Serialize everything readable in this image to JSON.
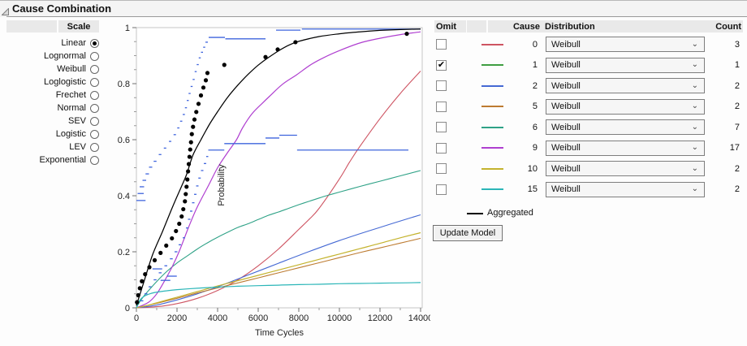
{
  "header": {
    "title": "Cause Combination"
  },
  "scale_panel": {
    "header": "Scale",
    "options": [
      {
        "label": "Linear",
        "selected": true
      },
      {
        "label": "Lognormal",
        "selected": false
      },
      {
        "label": "Weibull",
        "selected": false
      },
      {
        "label": "Loglogistic",
        "selected": false
      },
      {
        "label": "Frechet",
        "selected": false
      },
      {
        "label": "Normal",
        "selected": false
      },
      {
        "label": "SEV",
        "selected": false
      },
      {
        "label": "Logistic",
        "selected": false
      },
      {
        "label": "LEV",
        "selected": false
      },
      {
        "label": "Exponential",
        "selected": false
      }
    ]
  },
  "causes_table": {
    "headers": {
      "omit": "Omit",
      "cause": "Cause",
      "distribution": "Distribution",
      "count": "Count"
    },
    "distribution_selected": "Weibull",
    "rows": [
      {
        "omit": false,
        "color": "#ce5462",
        "cause": "0",
        "distribution": "Weibull",
        "count": "3"
      },
      {
        "omit": true,
        "color": "#3f9e42",
        "cause": "1",
        "distribution": "Weibull",
        "count": "1"
      },
      {
        "omit": false,
        "color": "#4569d4",
        "cause": "2",
        "distribution": "Weibull",
        "count": "2"
      },
      {
        "omit": false,
        "color": "#bd7b31",
        "cause": "5",
        "distribution": "Weibull",
        "count": "2"
      },
      {
        "omit": false,
        "color": "#2fa287",
        "cause": "6",
        "distribution": "Weibull",
        "count": "7"
      },
      {
        "omit": false,
        "color": "#af3fd0",
        "cause": "9",
        "distribution": "Weibull",
        "count": "17"
      },
      {
        "omit": false,
        "color": "#c4b32e",
        "cause": "10",
        "distribution": "Weibull",
        "count": "2"
      },
      {
        "omit": false,
        "color": "#2cb6b8",
        "cause": "15",
        "distribution": "Weibull",
        "count": "2"
      }
    ],
    "aggregated_label": "Aggregated",
    "aggregated_color": "#000000"
  },
  "update_button": "Update Model",
  "chart_data": {
    "type": "line",
    "xlabel": "Time Cycles",
    "ylabel": "Probability",
    "xlim": [
      0,
      14000
    ],
    "ylim": [
      0,
      1
    ],
    "xticks": [
      0,
      2000,
      4000,
      6000,
      8000,
      10000,
      12000,
      14000
    ],
    "yticks": [
      0,
      0.2,
      0.4,
      0.6,
      0.8,
      1
    ],
    "x_minor_step": 1000,
    "y_minor_step": 0.05,
    "grid": false,
    "legend_position": "right-table",
    "series": [
      {
        "name": "cause-0",
        "color": "#ce5462",
        "width": 1.1,
        "points": [
          [
            0,
            0
          ],
          [
            1000,
            0.004
          ],
          [
            2000,
            0.015
          ],
          [
            3000,
            0.034
          ],
          [
            4000,
            0.062
          ],
          [
            5000,
            0.1
          ],
          [
            6000,
            0.15
          ],
          [
            7000,
            0.21
          ],
          [
            8000,
            0.28
          ],
          [
            8500,
            0.315
          ],
          [
            9000,
            0.355
          ],
          [
            10000,
            0.46
          ],
          [
            10500,
            0.52
          ],
          [
            11000,
            0.575
          ],
          [
            12000,
            0.675
          ],
          [
            13000,
            0.765
          ],
          [
            14000,
            0.845
          ]
        ]
      },
      {
        "name": "cause-2",
        "color": "#4569d4",
        "width": 1.1,
        "points": [
          [
            0,
            0
          ],
          [
            500,
            0.004
          ],
          [
            1000,
            0.01
          ],
          [
            2000,
            0.028
          ],
          [
            3000,
            0.05
          ],
          [
            4000,
            0.075
          ],
          [
            5000,
            0.103
          ],
          [
            6000,
            0.131
          ],
          [
            7000,
            0.159
          ],
          [
            8000,
            0.187
          ],
          [
            9000,
            0.214
          ],
          [
            10000,
            0.24
          ],
          [
            11000,
            0.264
          ],
          [
            12000,
            0.287
          ],
          [
            13000,
            0.31
          ],
          [
            14000,
            0.332
          ]
        ]
      },
      {
        "name": "cause-5",
        "color": "#bd7b31",
        "width": 1.1,
        "points": [
          [
            0,
            0
          ],
          [
            1000,
            0.016
          ],
          [
            2000,
            0.034
          ],
          [
            3000,
            0.053
          ],
          [
            4000,
            0.071
          ],
          [
            5000,
            0.089
          ],
          [
            6000,
            0.107
          ],
          [
            7000,
            0.125
          ],
          [
            8000,
            0.143
          ],
          [
            9000,
            0.161
          ],
          [
            10000,
            0.179
          ],
          [
            11000,
            0.197
          ],
          [
            12000,
            0.214
          ],
          [
            13000,
            0.231
          ],
          [
            14000,
            0.248
          ]
        ]
      },
      {
        "name": "cause-6",
        "color": "#2fa287",
        "width": 1.1,
        "points": [
          [
            0,
            0
          ],
          [
            150,
            0.02
          ],
          [
            400,
            0.045
          ],
          [
            700,
            0.07
          ],
          [
            1000,
            0.094
          ],
          [
            1500,
            0.13
          ],
          [
            2000,
            0.16
          ],
          [
            2500,
            0.185
          ],
          [
            3000,
            0.21
          ],
          [
            3500,
            0.232
          ],
          [
            4000,
            0.252
          ],
          [
            4500,
            0.27
          ],
          [
            5000,
            0.287
          ],
          [
            5500,
            0.3
          ],
          [
            6000,
            0.315
          ],
          [
            6500,
            0.33
          ],
          [
            7000,
            0.342
          ],
          [
            7500,
            0.355
          ],
          [
            8000,
            0.368
          ],
          [
            8500,
            0.38
          ],
          [
            9000,
            0.392
          ],
          [
            9500,
            0.403
          ],
          [
            10000,
            0.413
          ],
          [
            11000,
            0.433
          ],
          [
            12000,
            0.452
          ],
          [
            13000,
            0.471
          ],
          [
            14000,
            0.49
          ]
        ]
      },
      {
        "name": "cause-9",
        "color": "#af3fd0",
        "width": 1.2,
        "points": [
          [
            0,
            0
          ],
          [
            600,
            0.02
          ],
          [
            1000,
            0.05
          ],
          [
            1400,
            0.098
          ],
          [
            1750,
            0.145
          ],
          [
            2100,
            0.2
          ],
          [
            2585,
            0.29
          ],
          [
            3000,
            0.36
          ],
          [
            3540,
            0.435
          ],
          [
            4000,
            0.5
          ],
          [
            4500,
            0.555
          ],
          [
            4930,
            0.6
          ],
          [
            5250,
            0.645
          ],
          [
            5700,
            0.693
          ],
          [
            6200,
            0.73
          ],
          [
            6560,
            0.755
          ],
          [
            7200,
            0.798
          ],
          [
            7900,
            0.832
          ],
          [
            8600,
            0.868
          ],
          [
            9230,
            0.893
          ],
          [
            10000,
            0.918
          ],
          [
            11000,
            0.945
          ],
          [
            12000,
            0.962
          ],
          [
            13000,
            0.975
          ],
          [
            14000,
            0.985
          ]
        ]
      },
      {
        "name": "cause-10",
        "color": "#c4b32e",
        "width": 1.2,
        "points": [
          [
            0,
            0
          ],
          [
            500,
            0.008
          ],
          [
            1000,
            0.018
          ],
          [
            2000,
            0.038
          ],
          [
            3000,
            0.058
          ],
          [
            4000,
            0.078
          ],
          [
            5000,
            0.097
          ],
          [
            6000,
            0.116
          ],
          [
            7000,
            0.135
          ],
          [
            8000,
            0.154
          ],
          [
            9000,
            0.173
          ],
          [
            10000,
            0.192
          ],
          [
            11000,
            0.211
          ],
          [
            12000,
            0.23
          ],
          [
            13000,
            0.25
          ],
          [
            14000,
            0.268
          ]
        ]
      },
      {
        "name": "cause-15",
        "color": "#2cb6b8",
        "width": 1.2,
        "points": [
          [
            0,
            0
          ],
          [
            80,
            0.015
          ],
          [
            200,
            0.03
          ],
          [
            400,
            0.042
          ],
          [
            700,
            0.051
          ],
          [
            1000,
            0.056
          ],
          [
            1500,
            0.061
          ],
          [
            2000,
            0.065
          ],
          [
            3000,
            0.07
          ],
          [
            4000,
            0.074
          ],
          [
            5000,
            0.077
          ],
          [
            6000,
            0.079
          ],
          [
            7000,
            0.081
          ],
          [
            8000,
            0.083
          ],
          [
            9000,
            0.084
          ],
          [
            10000,
            0.086
          ],
          [
            11000,
            0.087
          ],
          [
            12000,
            0.088
          ],
          [
            13000,
            0.089
          ],
          [
            14000,
            0.09
          ]
        ]
      },
      {
        "name": "aggregated",
        "color": "#000000",
        "width": 1.25,
        "points": [
          [
            0,
            0.008
          ],
          [
            400,
            0.1
          ],
          [
            800,
            0.19
          ],
          [
            1270,
            0.27
          ],
          [
            1790,
            0.362
          ],
          [
            2200,
            0.43
          ],
          [
            2466,
            0.475
          ],
          [
            2785,
            0.545
          ],
          [
            3180,
            0.6
          ],
          [
            3600,
            0.655
          ],
          [
            4000,
            0.7
          ],
          [
            4500,
            0.752
          ],
          [
            5000,
            0.795
          ],
          [
            5500,
            0.833
          ],
          [
            6000,
            0.866
          ],
          [
            6500,
            0.893
          ],
          [
            7000,
            0.917
          ],
          [
            7500,
            0.937
          ],
          [
            8000,
            0.951
          ],
          [
            9000,
            0.968
          ],
          [
            10000,
            0.978
          ],
          [
            11000,
            0.985
          ],
          [
            12000,
            0.99
          ],
          [
            13000,
            0.993
          ],
          [
            14000,
            0.995
          ]
        ]
      }
    ],
    "scatter": {
      "name": "observed-probability-points",
      "color": "#000000",
      "radius": 2.6,
      "points": [
        [
          30,
          0.02
        ],
        [
          90,
          0.045
        ],
        [
          170,
          0.07
        ],
        [
          270,
          0.095
        ],
        [
          430,
          0.12
        ],
        [
          640,
          0.145
        ],
        [
          900,
          0.17
        ],
        [
          1190,
          0.196
        ],
        [
          1470,
          0.222
        ],
        [
          1750,
          0.248
        ],
        [
          1950,
          0.274
        ],
        [
          2110,
          0.3
        ],
        [
          2230,
          0.326
        ],
        [
          2310,
          0.352
        ],
        [
          2390,
          0.38
        ],
        [
          2430,
          0.406
        ],
        [
          2470,
          0.432
        ],
        [
          2510,
          0.458
        ],
        [
          2545,
          0.487
        ],
        [
          2580,
          0.513
        ],
        [
          2615,
          0.539
        ],
        [
          2650,
          0.565
        ],
        [
          2690,
          0.591
        ],
        [
          2730,
          0.62
        ],
        [
          2790,
          0.646
        ],
        [
          2860,
          0.672
        ],
        [
          2950,
          0.699
        ],
        [
          3060,
          0.728
        ],
        [
          3180,
          0.758
        ],
        [
          3300,
          0.786
        ],
        [
          3420,
          0.812
        ],
        [
          3500,
          0.838
        ],
        [
          4330,
          0.867
        ],
        [
          6360,
          0.895
        ],
        [
          6960,
          0.922
        ],
        [
          7835,
          0.948
        ],
        [
          13320,
          0.978
        ]
      ]
    },
    "intervals": {
      "name": "nonparametric-interval-marks",
      "color": "#3e64dd",
      "width": 1.3,
      "segments": [
        [
          0,
          450,
          0.383
        ],
        [
          60,
          360,
          0.408
        ],
        [
          160,
          380,
          0.432
        ],
        [
          300,
          480,
          0.455
        ],
        [
          450,
          620,
          0.478
        ],
        [
          620,
          780,
          0.502
        ],
        [
          850,
          990,
          0.523
        ],
        [
          1100,
          1230,
          0.547
        ],
        [
          1350,
          1470,
          0.57
        ],
        [
          1600,
          1720,
          0.594
        ],
        [
          1830,
          1950,
          0.618
        ],
        [
          2010,
          2120,
          0.642
        ],
        [
          2150,
          2260,
          0.666
        ],
        [
          2280,
          2390,
          0.69
        ],
        [
          2390,
          2490,
          0.714
        ],
        [
          2480,
          2580,
          0.74
        ],
        [
          2570,
          2670,
          0.765
        ],
        [
          2670,
          2770,
          0.79
        ],
        [
          2770,
          2870,
          0.815
        ],
        [
          2870,
          2970,
          0.843
        ],
        [
          2970,
          3070,
          0.868
        ],
        [
          3070,
          3170,
          0.892
        ],
        [
          3180,
          3280,
          0.912
        ],
        [
          3290,
          3390,
          0.93
        ],
        [
          3400,
          3520,
          0.948
        ],
        [
          3560,
          4360,
          0.965
        ],
        [
          4380,
          6360,
          0.96
        ],
        [
          6880,
          8080,
          0.991
        ],
        [
          8150,
          14000,
          0.995
        ],
        [
          200,
          340,
          0.025
        ],
        [
          400,
          540,
          0.05
        ],
        [
          600,
          740,
          0.075
        ],
        [
          850,
          990,
          0.1
        ],
        [
          1100,
          1240,
          0.125
        ],
        [
          795,
          1270,
          0.139
        ],
        [
          1190,
          1670,
          0.098
        ],
        [
          1510,
          1990,
          0.113
        ],
        [
          1380,
          1520,
          0.15
        ],
        [
          1650,
          1790,
          0.175
        ],
        [
          1880,
          2020,
          0.2
        ],
        [
          2080,
          2200,
          0.225
        ],
        [
          2280,
          2400,
          0.25
        ],
        [
          2440,
          2560,
          0.285
        ],
        [
          2540,
          2660,
          0.316
        ],
        [
          2640,
          2760,
          0.345
        ],
        [
          2740,
          2860,
          0.375
        ],
        [
          2840,
          2960,
          0.405
        ],
        [
          2940,
          3060,
          0.435
        ],
        [
          3050,
          3170,
          0.463
        ],
        [
          3180,
          3300,
          0.49
        ],
        [
          3320,
          3440,
          0.515
        ],
        [
          3440,
          3540,
          0.54
        ],
        [
          3540,
          4330,
          0.563
        ],
        [
          4330,
          6360,
          0.586
        ],
        [
          6360,
          7040,
          0.606
        ],
        [
          7040,
          7915,
          0.616
        ],
        [
          7915,
          13400,
          0.563
        ]
      ]
    }
  }
}
